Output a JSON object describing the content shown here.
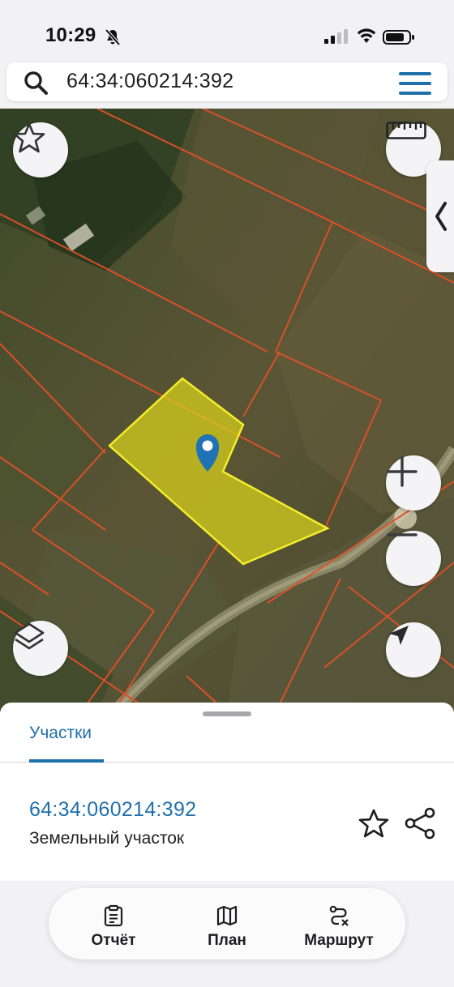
{
  "status_bar": {
    "time": "10:29"
  },
  "search": {
    "query": "64:34:060214:392"
  },
  "map": {
    "icons": [
      "star-icon",
      "ruler-icon",
      "chevron-left-icon",
      "location-pin-icon",
      "plus-icon",
      "minus-icon",
      "layers-icon",
      "navigate-arrow-icon"
    ]
  },
  "sheet": {
    "tab_label": "Участки",
    "result": {
      "id": "64:34:060214:392",
      "type": "Земельный участок"
    }
  },
  "bottom_nav": {
    "report_label": "Отчёт",
    "plan_label": "План",
    "route_label": "Маршрут"
  },
  "colors": {
    "accent": "#1f6faa",
    "parcel_fill": "#d9d21c",
    "parcel_border": "#f2ee2a",
    "boundary": "#e0502a"
  }
}
